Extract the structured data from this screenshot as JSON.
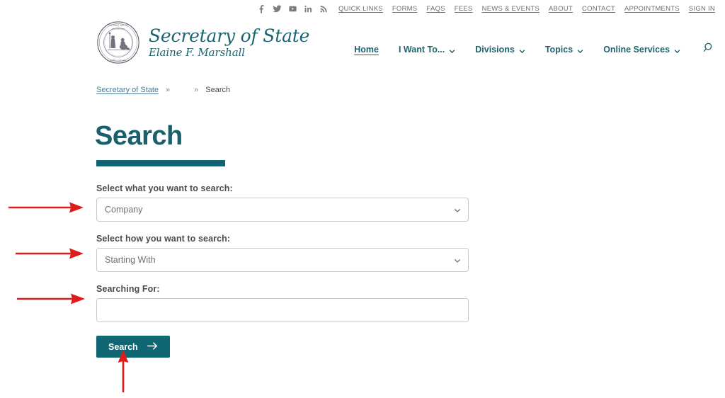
{
  "utility_bar": {
    "social": [
      {
        "name": "facebook-icon",
        "label": "Facebook"
      },
      {
        "name": "twitter-icon",
        "label": "Twitter"
      },
      {
        "name": "youtube-icon",
        "label": "YouTube"
      },
      {
        "name": "linkedin-icon",
        "label": "LinkedIn"
      },
      {
        "name": "rss-icon",
        "label": "RSS Feed"
      }
    ],
    "links": [
      {
        "label": "QUICK LINKS"
      },
      {
        "label": "FORMS"
      },
      {
        "label": "FAQS"
      },
      {
        "label": "FEES"
      },
      {
        "label": "NEWS & EVENTS"
      },
      {
        "label": "ABOUT"
      },
      {
        "label": "CONTACT"
      },
      {
        "label": "APPOINTMENTS"
      },
      {
        "label": "SIGN IN"
      }
    ]
  },
  "brand": {
    "title": "Secretary of State",
    "subtitle": "Elaine F. Marshall",
    "seal_icon": "nc-state-seal"
  },
  "nav": {
    "items": [
      {
        "label": "Home",
        "has_chevron": false,
        "active": true
      },
      {
        "label": "I Want To...",
        "has_chevron": true,
        "active": false
      },
      {
        "label": "Divisions",
        "has_chevron": true,
        "active": false
      },
      {
        "label": "Topics",
        "has_chevron": true,
        "active": false
      },
      {
        "label": "Online Services",
        "has_chevron": true,
        "active": false
      }
    ],
    "search_icon": "search-icon"
  },
  "breadcrumb": {
    "home": "Secretary of State",
    "separator": "»",
    "current": "Search"
  },
  "page": {
    "title": "Search"
  },
  "form": {
    "what_label": "Select what you want to search:",
    "what_value": "Company",
    "how_label": "Select how you want to search:",
    "how_value": "Starting With",
    "term_label": "Searching For:",
    "term_value": "",
    "term_placeholder": "",
    "submit_label": "Search",
    "submit_icon": "arrow-right-icon"
  },
  "colors": {
    "teal": "#136271",
    "button_teal": "#0f6774",
    "brand_teal": "#1d6470",
    "annotation_red": "#e01b1b",
    "border_gray": "#c9c9c9",
    "label_gray": "#4c4c4c"
  },
  "annotations": [
    {
      "name": "arrow-to-what-select",
      "direction": "right"
    },
    {
      "name": "arrow-to-how-select",
      "direction": "right"
    },
    {
      "name": "arrow-to-search-input",
      "direction": "right"
    },
    {
      "name": "arrow-to-search-button",
      "direction": "up"
    }
  ]
}
